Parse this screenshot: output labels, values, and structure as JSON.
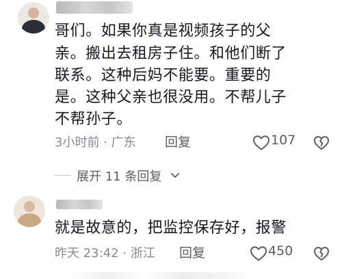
{
  "comments": [
    {
      "username": "",
      "text_lines": [
        "哥们。如果你真是视频孩子的父",
        "亲。搬出去租房子住。和他们断了",
        "联系。这种后妈不能要。重要的",
        "是。这种父亲也很没用。不帮儿子",
        "不帮孙子。"
      ],
      "meta": "3小时前 · 广东",
      "reply_label": "回复",
      "like_count": "107"
    },
    {
      "username": "",
      "text_lines": [
        "就是故意的，把监控保存好，报警"
      ],
      "meta": "昨天 23:42 · 浙江",
      "reply_label": "回复",
      "like_count": "450"
    }
  ],
  "expand_replies": {
    "label": "展开 11 条回复"
  },
  "icons": {
    "like": "heart-outline-icon",
    "dislike": "broken-heart-icon",
    "expand": "chevron-down-icon"
  },
  "colors": {
    "text": "#161823",
    "meta": "#8a8b91",
    "action": "#5c5e66",
    "background": "#ffffff"
  }
}
